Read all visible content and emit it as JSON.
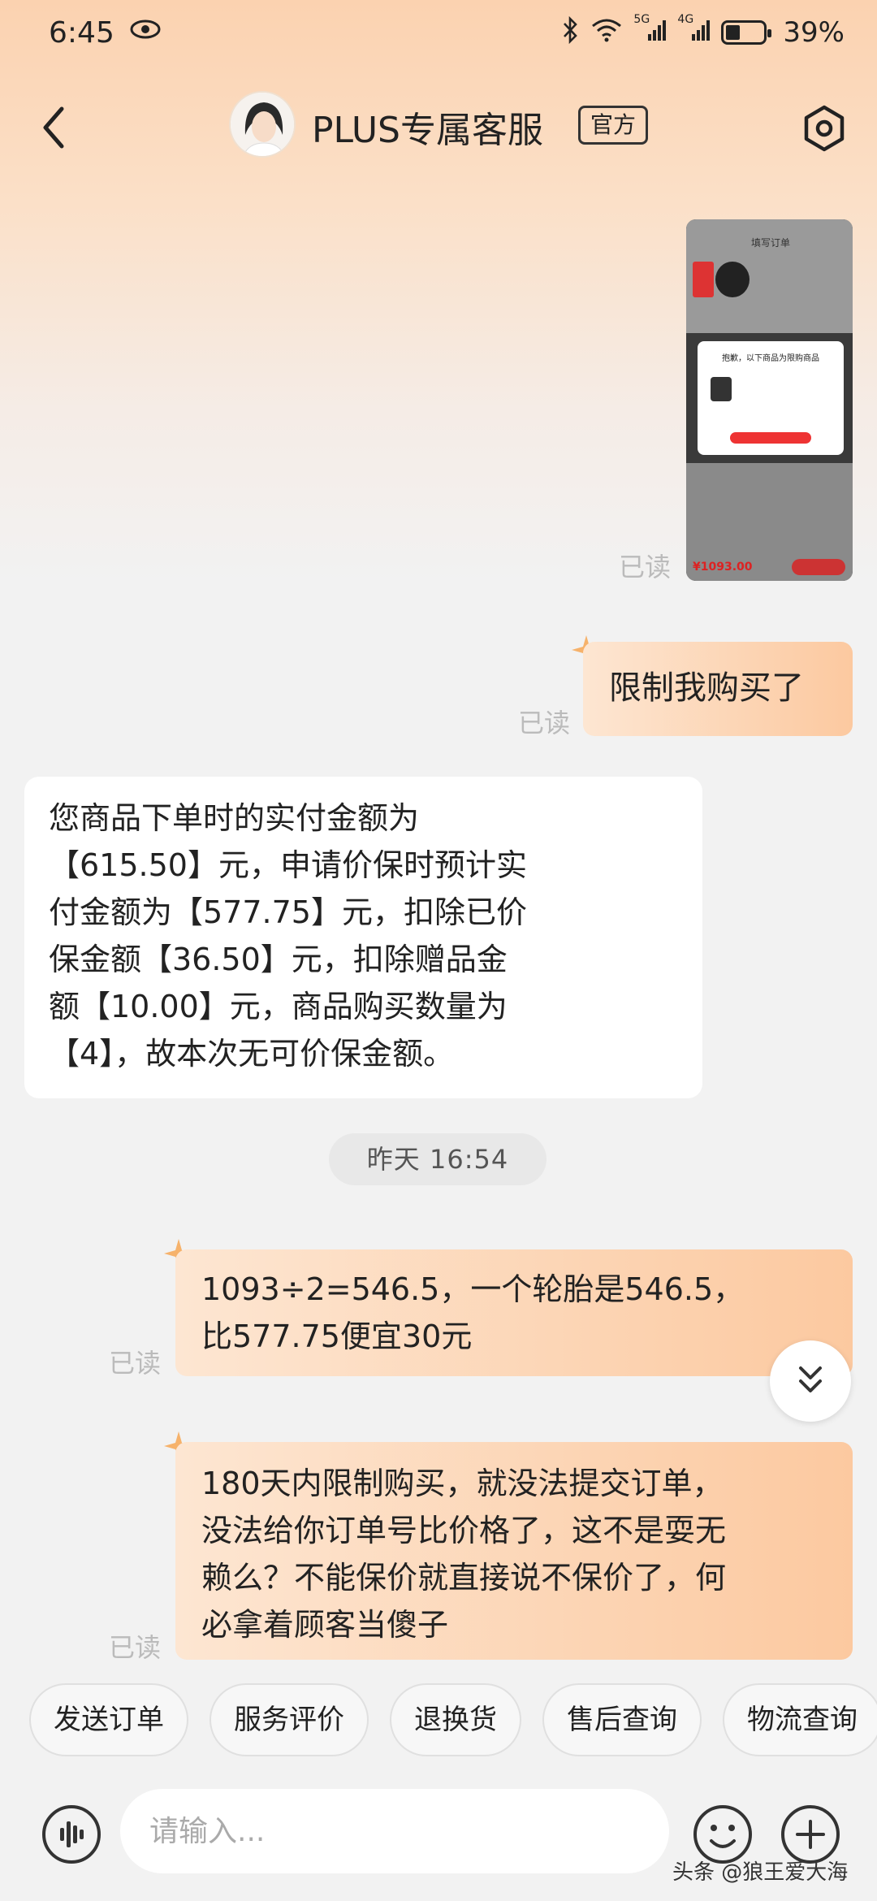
{
  "status_bar": {
    "time": "6:45",
    "battery_percent": "39%",
    "battery_level": 0.39,
    "network_labels": [
      "5G",
      "4G"
    ]
  },
  "header": {
    "title": "PLUS专属客服",
    "badge": "官方"
  },
  "messages": {
    "read_label": "已读",
    "m1_text": "限制我购买了",
    "m2_text": "您商品下单时的实付金额为\n【615.50】元，申请价保时预计实\n付金额为【577.75】元，扣除已价\n保金额【36.50】元，扣除赠品金\n额【10.00】元，商品购买数量为\n【4】，故本次无可价保金额。",
    "timestamp": "昨天  16:54",
    "m3_text": "1093÷2=546.5，一个轮胎是546.5，\n比577.75便宜30元",
    "m4_text": "180天内限制购买，就没法提交订单，\n没法给你订单号比价格了，这不是耍无\n赖么？不能保价就直接说不保价了，何\n必拿着顾客当傻子"
  },
  "screenshot_thumb": {
    "page_title": "填写订单",
    "dialog_title": "抱歉，以下商品为限购商品",
    "total_price": "¥1093.00"
  },
  "quick_replies": [
    "发送订单",
    "服务评价",
    "退换货",
    "售后查询",
    "物流查询"
  ],
  "input": {
    "placeholder": "请输入..."
  },
  "watermark": "头条 @狼王爱大海",
  "colors": {
    "accent_orange": "#fcc9a0",
    "header_gradient": "#fbd2b0",
    "background": "#f2f2f2"
  },
  "icons": [
    "back-arrow-icon",
    "settings-hexagon-icon",
    "voice-icon",
    "emoji-icon",
    "plus-icon",
    "double-chevron-down-icon",
    "star-icon"
  ]
}
